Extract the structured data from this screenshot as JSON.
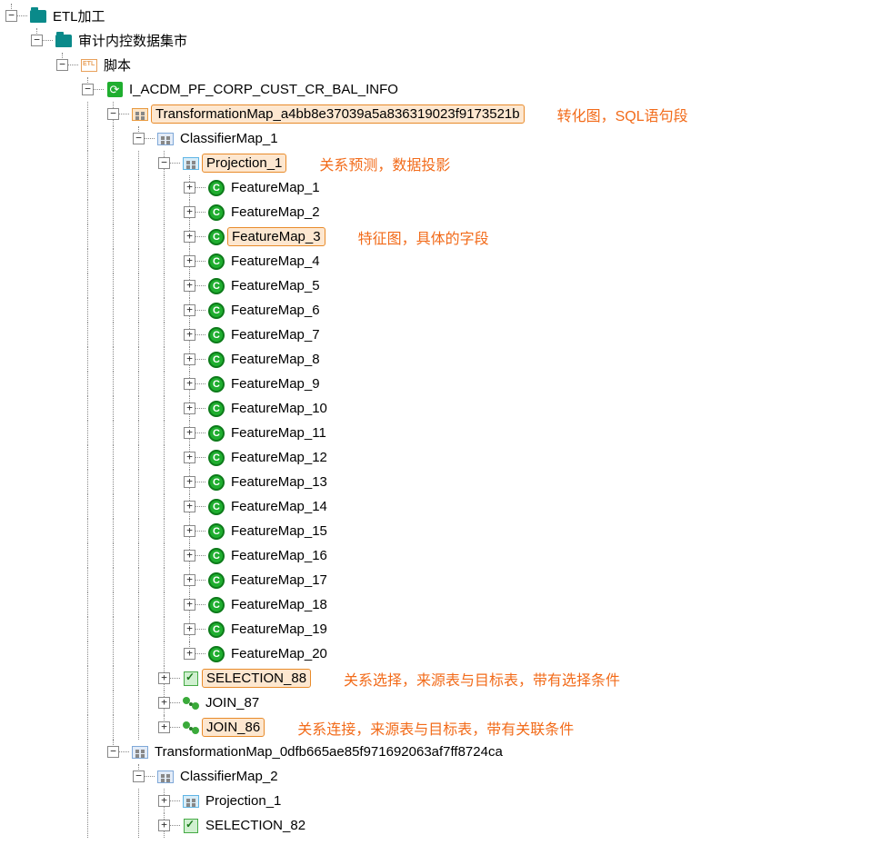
{
  "tree": {
    "root": "ETL加工",
    "datamart": "审计内控数据集市",
    "scripts": "脚本",
    "job": "I_ACDM_PF_CORP_CUST_CR_BAL_INFO",
    "tmap1": "TransformationMap_a4bb8e37039a5a836319023f9173521b",
    "cmap1": "ClassifierMap_1",
    "proj1": "Projection_1",
    "features": [
      "FeatureMap_1",
      "FeatureMap_2",
      "FeatureMap_3",
      "FeatureMap_4",
      "FeatureMap_5",
      "FeatureMap_6",
      "FeatureMap_7",
      "FeatureMap_8",
      "FeatureMap_9",
      "FeatureMap_10",
      "FeatureMap_11",
      "FeatureMap_12",
      "FeatureMap_13",
      "FeatureMap_14",
      "FeatureMap_15",
      "FeatureMap_16",
      "FeatureMap_17",
      "FeatureMap_18",
      "FeatureMap_19",
      "FeatureMap_20"
    ],
    "sel88": "SELECTION_88",
    "join87": "JOIN_87",
    "join86": "JOIN_86",
    "tmap2": "TransformationMap_0dfb665ae85f971692063af7ff8724ca",
    "cmap2": "ClassifierMap_2",
    "proj2": "Projection_1",
    "sel82": "SELECTION_82"
  },
  "annot": {
    "tmap": "转化图，SQL语句段",
    "proj": "关系预测，数据投影",
    "feat": "特征图，具体的字段",
    "sel": "关系选择，来源表与目标表，带有选择条件",
    "join": "关系连接，来源表与目标表，带有关联条件"
  },
  "highlight_feature_index": 2
}
